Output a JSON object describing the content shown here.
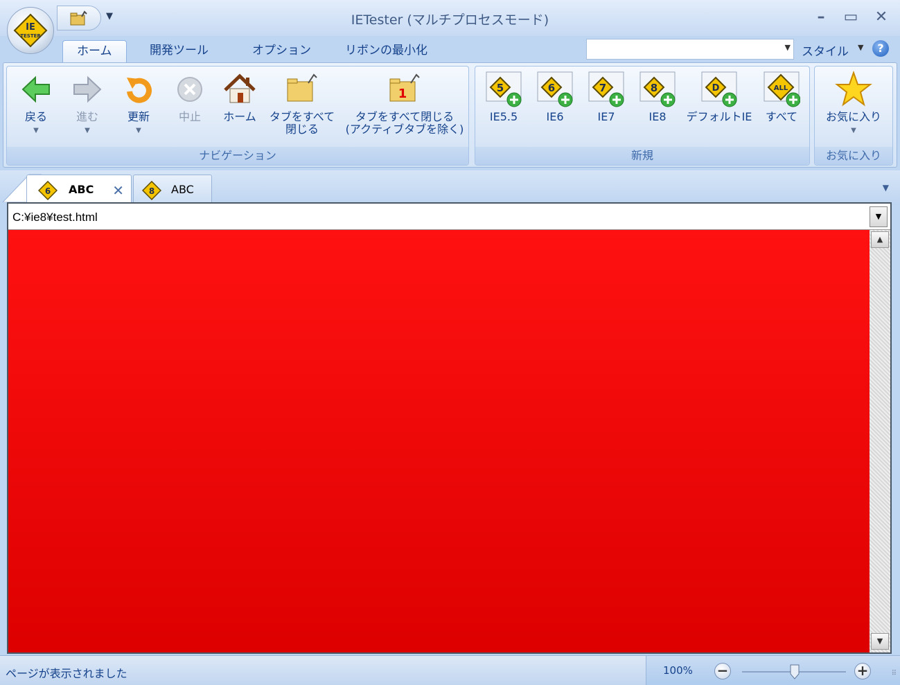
{
  "window": {
    "title": "IETester (マルチプロセスモード)",
    "logo_text": "IE\nTESTER"
  },
  "ribbon_tabs": [
    {
      "label": "ホーム",
      "active": true
    },
    {
      "label": "開発ツール"
    },
    {
      "label": "オプション"
    },
    {
      "label": "リボンの最小化"
    }
  ],
  "style_menu": {
    "label": "スタイル",
    "value": ""
  },
  "groups": {
    "navigation": {
      "label": "ナビゲーション",
      "buttons": {
        "back": "戻る",
        "forward": "進む",
        "refresh": "更新",
        "stop": "中止",
        "home": "ホーム",
        "close_all_1": "タブをすべて",
        "close_all_2": "閉じる",
        "close_others_1": "タブをすべて閉じる",
        "close_others_2": "(アクティブタブを除く)"
      }
    },
    "new": {
      "label": "新規",
      "buttons": {
        "ie55": "IE5.5",
        "ie6": "IE6",
        "ie7": "IE7",
        "ie8": "IE8",
        "default_ie": "デフォルトIE",
        "all": "すべて"
      },
      "badges": {
        "ie55": "5",
        "ie6": "6",
        "ie7": "7",
        "ie8": "8",
        "default_ie": "D",
        "all": "ALL"
      }
    },
    "favorites": {
      "label": "お気に入り",
      "button": "お気に入り"
    }
  },
  "doc_tabs": [
    {
      "label": "ABC",
      "badge": "6",
      "active": true
    },
    {
      "label": "ABC",
      "badge": "8",
      "active": false
    }
  ],
  "address": {
    "value": "C:¥ie8¥test.html"
  },
  "content": {
    "background": "#ee0000"
  },
  "status": {
    "text": "ページが表示されました",
    "zoom": "100%"
  },
  "colors": {
    "ribbon_text": "#15428b",
    "page_red": "#ee0000",
    "badge_yellow": "#f5c400",
    "add_green": "#3cb043"
  }
}
